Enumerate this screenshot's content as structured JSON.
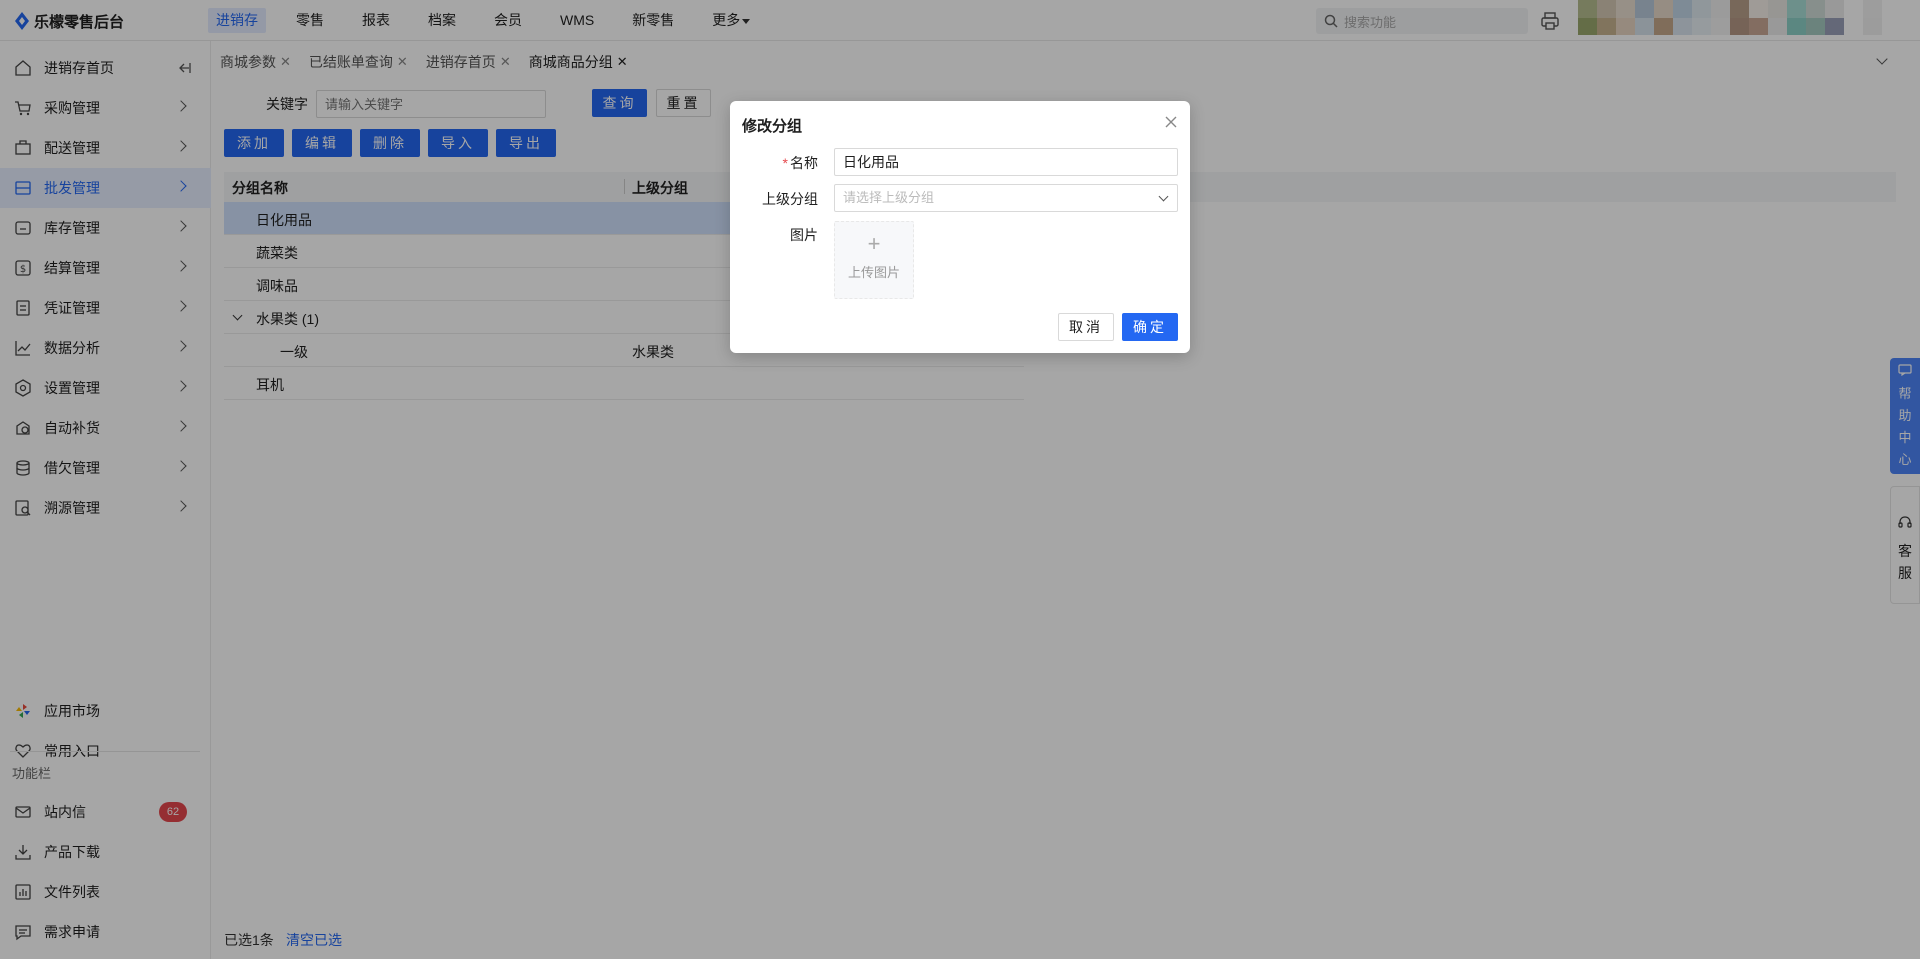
{
  "app": {
    "title": "乐檬零售后台"
  },
  "topnav": {
    "items": [
      {
        "label": "进销存"
      },
      {
        "label": "零售"
      },
      {
        "label": "报表"
      },
      {
        "label": "档案"
      },
      {
        "label": "会员"
      },
      {
        "label": "WMS"
      },
      {
        "label": "新零售"
      },
      {
        "label": "更多"
      }
    ],
    "search_placeholder": "搜索功能"
  },
  "sidebar": {
    "items": [
      {
        "label": "进销存首页",
        "icon": "home-icon"
      },
      {
        "label": "采购管理",
        "icon": "cart-icon"
      },
      {
        "label": "配送管理",
        "icon": "delivery-icon"
      },
      {
        "label": "批发管理",
        "icon": "wholesale-icon"
      },
      {
        "label": "库存管理",
        "icon": "inventory-icon"
      },
      {
        "label": "结算管理",
        "icon": "settlement-icon"
      },
      {
        "label": "凭证管理",
        "icon": "voucher-icon"
      },
      {
        "label": "数据分析",
        "icon": "chart-icon"
      },
      {
        "label": "设置管理",
        "icon": "settings-icon"
      },
      {
        "label": "自动补货",
        "icon": "replenish-icon"
      },
      {
        "label": "借欠管理",
        "icon": "debt-icon"
      },
      {
        "label": "溯源管理",
        "icon": "trace-icon"
      }
    ],
    "bottom": [
      {
        "label": "应用市场",
        "icon": "app-market-icon"
      },
      {
        "label": "常用入口",
        "icon": "heart-icon"
      }
    ],
    "section_title": "功能栏",
    "func": [
      {
        "label": "站内信",
        "icon": "mail-icon",
        "badge": "62"
      },
      {
        "label": "产品下载",
        "icon": "download-icon"
      },
      {
        "label": "文件列表",
        "icon": "file-list-icon"
      },
      {
        "label": "需求申请",
        "icon": "request-icon"
      }
    ]
  },
  "tabs": [
    {
      "label": "商城参数"
    },
    {
      "label": "已结账单查询"
    },
    {
      "label": "进销存首页"
    },
    {
      "label": "商城商品分组"
    }
  ],
  "filter": {
    "keyword_label": "关键字",
    "keyword_placeholder": "请输入关键字",
    "query": "查询",
    "reset": "重置"
  },
  "toolbar": {
    "add": "添加",
    "edit": "编辑",
    "delete": "删除",
    "import": "导入",
    "export": "导出"
  },
  "table": {
    "columns": [
      "分组名称",
      "上级分组"
    ],
    "rows": [
      {
        "name": "日化用品",
        "parent": ""
      },
      {
        "name": "蔬菜类",
        "parent": ""
      },
      {
        "name": "调味品",
        "parent": ""
      },
      {
        "name": "水果类 (1)",
        "parent": ""
      },
      {
        "name": "一级",
        "parent": "水果类"
      },
      {
        "name": "耳机",
        "parent": ""
      }
    ]
  },
  "footer": {
    "selected": "已选1条",
    "clear": "清空已选"
  },
  "float": {
    "help": "帮助中心",
    "service": "客服"
  },
  "modal": {
    "title": "修改分组",
    "name_label": "名称",
    "name_value": "日化用品",
    "parent_label": "上级分组",
    "parent_placeholder": "请选择上级分组",
    "image_label": "图片",
    "upload_label": "上传图片",
    "cancel": "取消",
    "ok": "确定"
  },
  "colors": {
    "primary": "#2468f2",
    "badge": "#e5484d",
    "help_tab": "#4d84f7"
  }
}
